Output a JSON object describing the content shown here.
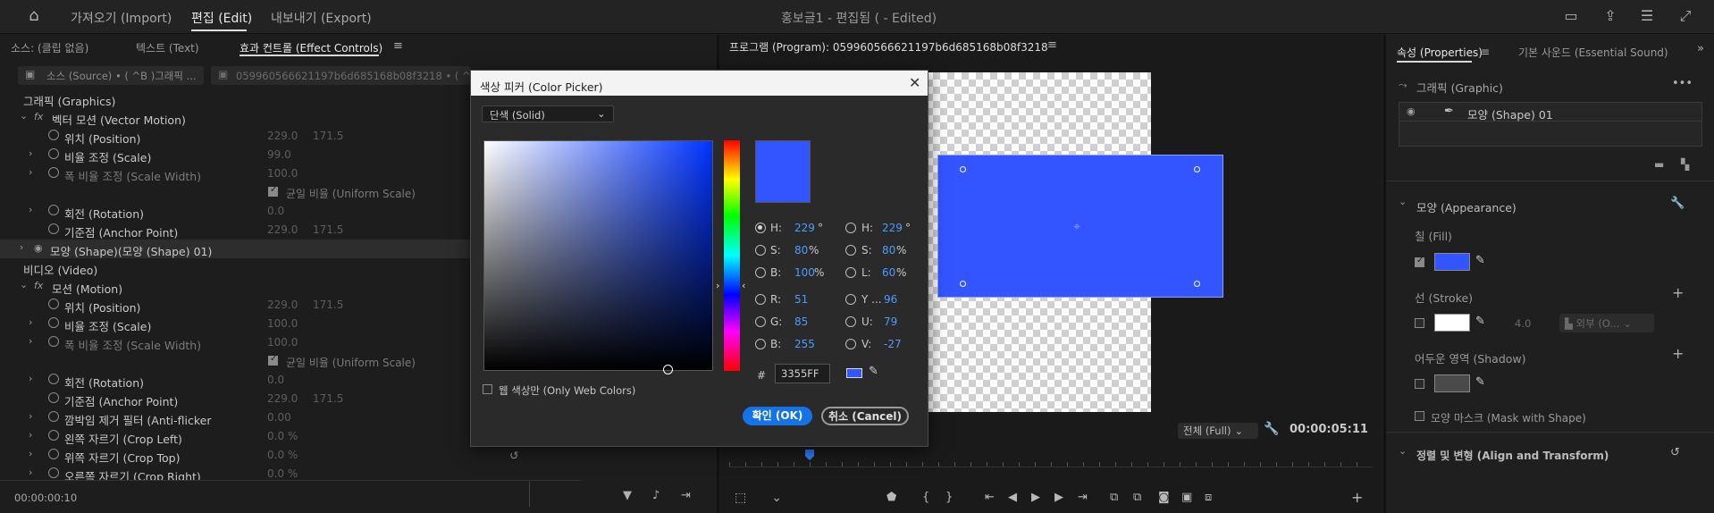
{
  "topbar": {
    "home_icon": "home-icon",
    "tabs": [
      "가져오기 (Import)",
      "편집 (Edit)",
      "내보내기 (Export)"
    ],
    "title": "홍보글1 - 편집됨 ( - Edited)"
  },
  "left_panel": {
    "tabs": [
      "소스: (클립 없음)",
      "텍스트 (Text)",
      "효과 컨트롤 (Effect Controls)"
    ],
    "menu_icon": "≡",
    "source_label": "소스 (Source) • ( ^B )그래픽 ...",
    "sequence_label": "059960566621197b6d685168b08f3218 • ( ^B )그...",
    "rows": [
      {
        "label": "그래픽 (Graphics)"
      },
      {
        "label": "벡터 모션 (Vector Motion)"
      },
      {
        "label": "위치 (Position)",
        "v1": "229.0",
        "v2": "171.5"
      },
      {
        "label": "비율 조정 (Scale)",
        "v1": "99.0"
      },
      {
        "label": "폭 비율 조정 (Scale Width)",
        "v1": "100.0"
      },
      {
        "label": "균일 비율 (Uniform Scale)"
      },
      {
        "label": "회전 (Rotation)",
        "v1": "0.0"
      },
      {
        "label": "기준점 (Anchor Point)",
        "v1": "229.0",
        "v2": "171.5"
      },
      {
        "label": "모양 (Shape)(모양 (Shape) 01)"
      },
      {
        "label": "비디오 (Video)"
      },
      {
        "label": "모션 (Motion)"
      },
      {
        "label": "위치 (Position)",
        "v1": "229.0",
        "v2": "171.5"
      },
      {
        "label": "비율 조정 (Scale)",
        "v1": "100.0"
      },
      {
        "label": "폭 비율 조정 (Scale Width)",
        "v1": "100.0"
      },
      {
        "label": "균일 비율 (Uniform Scale)"
      },
      {
        "label": "회전 (Rotation)",
        "v1": "0.0"
      },
      {
        "label": "기준점 (Anchor Point)",
        "v1": "229.0",
        "v2": "171.5"
      },
      {
        "label": "깜박임 제거 필터 (Anti-flicker",
        "v1": "0.00"
      },
      {
        "label": "왼쪽 자르기 (Crop Left)",
        "v1": "0.0 %"
      },
      {
        "label": "위쪽 자르기 (Crop Top)",
        "v1": "0.0 %"
      },
      {
        "label": "오른쪽 자르기 (Crop Right)",
        "v1": "0.0 %"
      }
    ],
    "timecode": "00:00:00:10"
  },
  "program": {
    "title": "프로그램 (Program): 059960566621197b6d685168b08f3218",
    "zoom": "전체 (Full)",
    "timecode": "00:00:05:11",
    "shape_color": "#3355FF"
  },
  "color_picker": {
    "title": "색상 피커 (Color Picker)",
    "mode": "단색 (Solid)",
    "hsb": {
      "h_label": "H:",
      "h": "229",
      "h_unit": "°",
      "s_label": "S:",
      "s": "80",
      "s_unit": "%",
      "b_label": "B:",
      "b": "100",
      "b_unit": "%"
    },
    "hsl": {
      "h_label": "H:",
      "h": "229",
      "h_unit": "°",
      "s_label": "S:",
      "s": "80",
      "s_unit": "%",
      "l_label": "L:",
      "l": "60",
      "l_unit": "%"
    },
    "rgb": {
      "r_label": "R:",
      "r": "51",
      "g_label": "G:",
      "g": "85",
      "b_label": "B:",
      "b": "255"
    },
    "yuv": {
      "y_label": "Y ...",
      "y": "96",
      "u_label": "U:",
      "u": "79",
      "v_label": "V:",
      "v": "-27"
    },
    "hash": "#",
    "hex": "3355FF",
    "web_colors": "웹 색상만 (Only Web Colors)",
    "ok": "확인 (OK)",
    "cancel": "취소 (Cancel)",
    "new_color": "#3355FF"
  },
  "properties": {
    "tabs": [
      "속성 (Properties)",
      "기본 사운드 (Essential Sound)"
    ],
    "graphic_label": "그래픽 (Graphic)",
    "layer_name": "모양 (Shape) 01",
    "appearance": "모양 (Appearance)",
    "fill": "칠 (Fill)",
    "fill_color": "#3355FF",
    "stroke": "선 (Stroke)",
    "stroke_width": "4.0",
    "stroke_position": "외부 (O...",
    "shadow": "어두운 영역 (Shadow)",
    "mask": "모양 마스크 (Mask with Shape)",
    "align": "정렬 및 변형 (Align and Transform)"
  }
}
